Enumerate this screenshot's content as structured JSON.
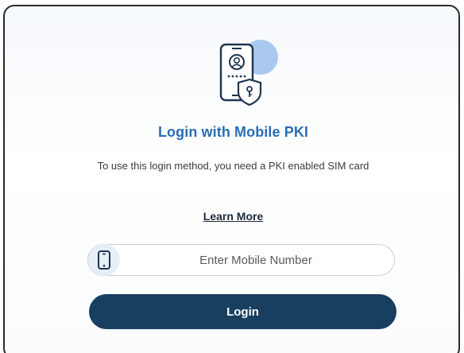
{
  "card": {
    "title": "Login with Mobile PKI",
    "subtitle": "To use this login method, you need a PKI enabled SIM card",
    "learn_more": "Learn More",
    "illustration_icon": "mobile-pki-icon"
  },
  "mobile_input": {
    "placeholder": "Enter Mobile Number",
    "value": "",
    "icon": "mobile-phone-icon"
  },
  "login_button": {
    "label": "Login"
  },
  "colors": {
    "title": "#2a6db5",
    "button": "#183e60",
    "icon_accent": "#a9c9ee"
  }
}
